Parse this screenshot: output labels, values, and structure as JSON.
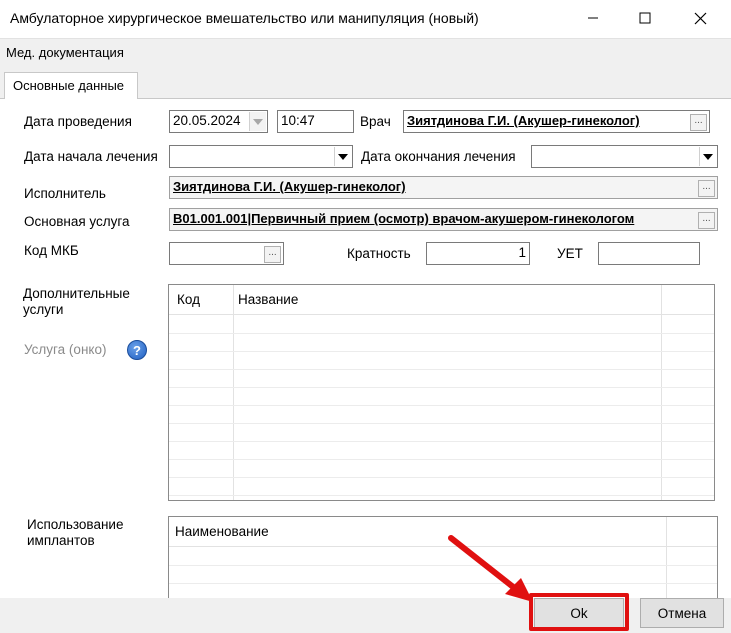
{
  "window": {
    "title": "Амбулаторное хирургическое вмешательство или манипуляция (новый)"
  },
  "menu": {
    "item": "Мед. документация"
  },
  "tab": {
    "label": "Основные данные"
  },
  "form": {
    "date_label": "Дата проведения",
    "date_value": "20.05.2024",
    "time_value": "10:47",
    "doctor_label": "Врач",
    "doctor_value": "Зиятдинова Г.И. (Акушер-гинеколог)",
    "start_label": "Дата начала лечения",
    "start_value": "",
    "end_label": "Дата окончания лечения",
    "end_value": "",
    "performer_label": "Исполнитель",
    "performer_value": "Зиятдинова Г.И. (Акушер-гинеколог)",
    "service_label": "Основная услуга",
    "service_value": "B01.001.001|Первичный прием (осмотр) врачом-акушером-гинекологом",
    "mkb_label": "Код МКБ",
    "mkb_value": "",
    "multiplicity_label": "Кратность",
    "multiplicity_value": "1",
    "uet_label": "УЕТ",
    "uet_value": "",
    "additional_label_1": "Дополнительные",
    "additional_label_2": "услуги",
    "onco_label": "Услуга (онко)",
    "implants_label_1": "Использование",
    "implants_label_2": "имплантов",
    "browse_glyph": "...",
    "help_glyph": "?"
  },
  "services_table": {
    "columns": [
      "Код",
      "Название"
    ]
  },
  "implants_table": {
    "columns": [
      "Наименование"
    ]
  },
  "buttons": {
    "ok": "Ok",
    "cancel": "Отмена"
  },
  "annotation": {
    "color": "#e01010"
  }
}
